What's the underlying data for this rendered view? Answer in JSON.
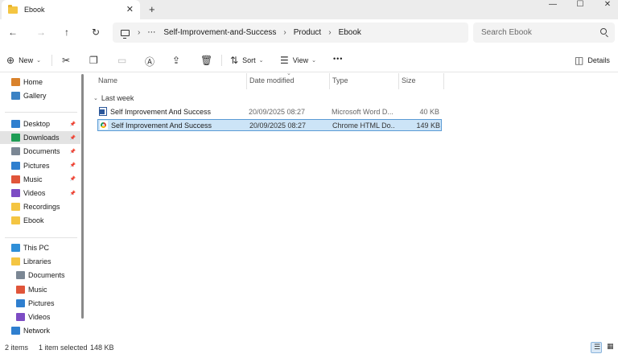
{
  "window": {
    "tab_title": "Ebook",
    "tab_close": "✕",
    "new_tab": "+",
    "minimize": "—",
    "maximize": "☐",
    "close": "✕"
  },
  "nav": {
    "back": "←",
    "forward": "→",
    "up": "↑",
    "refresh": "↻",
    "breadcrumb_more": "⋯",
    "breadcrumb": [
      "Self-Improvement-and-Success",
      "Product",
      "Ebook"
    ],
    "search_placeholder": "Search Ebook"
  },
  "toolbar": {
    "new_label": "New",
    "sort_label": "Sort",
    "view_label": "View",
    "more_label": "•••",
    "details_label": "Details"
  },
  "sidebar": {
    "quick": [
      {
        "label": "Home",
        "icon": "home-icon",
        "color": "#d9822b"
      },
      {
        "label": "Gallery",
        "icon": "gallery-icon",
        "color": "#3b82c4"
      }
    ],
    "pinned": [
      {
        "label": "Desktop",
        "icon": "desktop-icon",
        "color": "#2f7fcf",
        "pinned": true,
        "active": false
      },
      {
        "label": "Downloads",
        "icon": "downloads-icon",
        "color": "#1f9d55",
        "pinned": true,
        "active": true
      },
      {
        "label": "Documents",
        "icon": "documents-icon",
        "color": "#7b8794",
        "pinned": true,
        "active": false
      },
      {
        "label": "Pictures",
        "icon": "pictures-icon",
        "color": "#2f7fcf",
        "pinned": true,
        "active": false
      },
      {
        "label": "Music",
        "icon": "music-icon",
        "color": "#e0553a",
        "pinned": true,
        "active": false
      },
      {
        "label": "Videos",
        "icon": "videos-icon",
        "color": "#7d4cc4",
        "pinned": true,
        "active": false
      },
      {
        "label": "Recordings",
        "icon": "folder-icon",
        "color": "#f4c542",
        "pinned": false,
        "active": false
      },
      {
        "label": "Ebook",
        "icon": "folder-icon",
        "color": "#f4c542",
        "pinned": false,
        "active": false
      }
    ],
    "pc": [
      {
        "label": "This PC",
        "icon": "this-pc-icon",
        "color": "#2f8fd8",
        "indent": false
      },
      {
        "label": "Libraries",
        "icon": "libraries-icon",
        "color": "#f4c542",
        "indent": false
      },
      {
        "label": "Documents",
        "icon": "documents-icon",
        "color": "#7b8794",
        "indent": true
      },
      {
        "label": "Music",
        "icon": "music-icon",
        "color": "#e0553a",
        "indent": true
      },
      {
        "label": "Pictures",
        "icon": "pictures-icon",
        "color": "#2f7fcf",
        "indent": true
      },
      {
        "label": "Videos",
        "icon": "videos-icon",
        "color": "#7d4cc4",
        "indent": true
      },
      {
        "label": "Network",
        "icon": "network-icon",
        "color": "#2f7fcf",
        "indent": false
      }
    ]
  },
  "columns": {
    "name": "Name",
    "date": "Date modified",
    "type": "Type",
    "size": "Size"
  },
  "group_label": "Last week",
  "files": [
    {
      "name": "Self Improvement And Success",
      "date": "20/09/2025 08:27",
      "type": "Microsoft Word D...",
      "size": "40 KB",
      "icon": "word-doc-icon",
      "selected": false
    },
    {
      "name": "Self Improvement And Success",
      "date": "20/09/2025 08:27",
      "type": "Chrome HTML Do...",
      "size": "149 KB",
      "icon": "chrome-html-icon",
      "selected": true
    }
  ],
  "status": {
    "item_count": "2 items",
    "selection": "1 item selected",
    "selection_size": "148 KB"
  },
  "colors": {
    "selection_fill": "#cce4f7",
    "selection_border": "#5b9bd5",
    "folder": "#f4c542"
  }
}
